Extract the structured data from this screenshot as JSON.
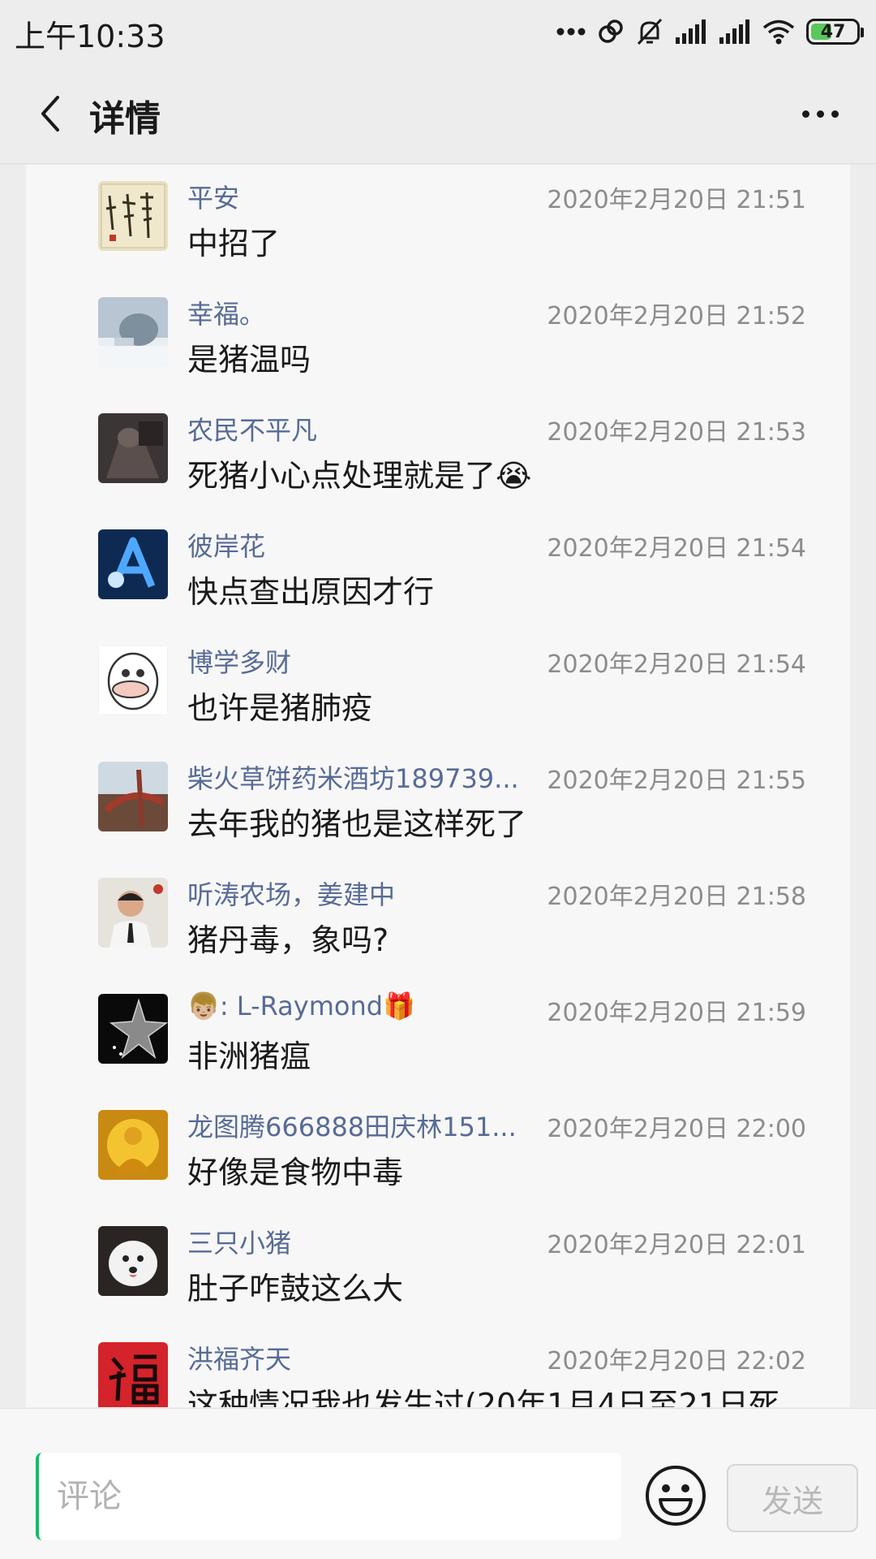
{
  "status_bar": {
    "time": "上午10:33",
    "battery": "47",
    "battery_level": 0.47,
    "icons": [
      "more-dots-icon",
      "link-icon",
      "mute-bell-icon",
      "signal-icon",
      "signal-icon",
      "wifi-icon",
      "battery-icon"
    ]
  },
  "nav": {
    "title": "详情",
    "back_icon": "chevron-left-icon",
    "more_icon": "more-horizontal-icon"
  },
  "comments": [
    {
      "name": "平安",
      "time": "2020年2月20日 21:51",
      "text": "中招了"
    },
    {
      "name": "幸福。",
      "time": "2020年2月20日 21:52",
      "text": "是猪温吗"
    },
    {
      "name": "农民不平凡",
      "time": "2020年2月20日 21:53",
      "text": "死猪小心点处理就是了😭"
    },
    {
      "name": "彼岸花",
      "time": "2020年2月20日 21:54",
      "text": "快点查出原因才行"
    },
    {
      "name": "博学多财",
      "time": "2020年2月20日 21:54",
      "text": "也许是猪肺疫"
    },
    {
      "name": "柴火草饼药米酒坊189739...",
      "time": "2020年2月20日 21:55",
      "text": "去年我的猪也是这样死了"
    },
    {
      "name": "听涛农场，姜建中",
      "time": "2020年2月20日 21:58",
      "text": "猪丹毒，象吗?"
    },
    {
      "name": "👦🏼: L-Raymond🎁",
      "time": "2020年2月20日 21:59",
      "text": "非洲猪瘟"
    },
    {
      "name": "龙图腾666888田庆林151...",
      "time": "2020年2月20日 22:00",
      "text": "好像是食物中毒"
    },
    {
      "name": "三只小猪",
      "time": "2020年2月20日 22:01",
      "text": "肚子咋鼓这么大"
    },
    {
      "name": "洪福齐天",
      "time": "2020年2月20日 22:02",
      "text": "这种情况我也发生过(20年1月4日至21日死"
    }
  ],
  "input": {
    "placeholder": "评论",
    "emoji_icon": "smiley-face-icon",
    "send_label": "发送"
  },
  "colors": {
    "name": "#576b95",
    "time": "#8c8c8c",
    "accent": "#07c160",
    "background": "#ededed",
    "list_background": "#f7f7f7"
  }
}
